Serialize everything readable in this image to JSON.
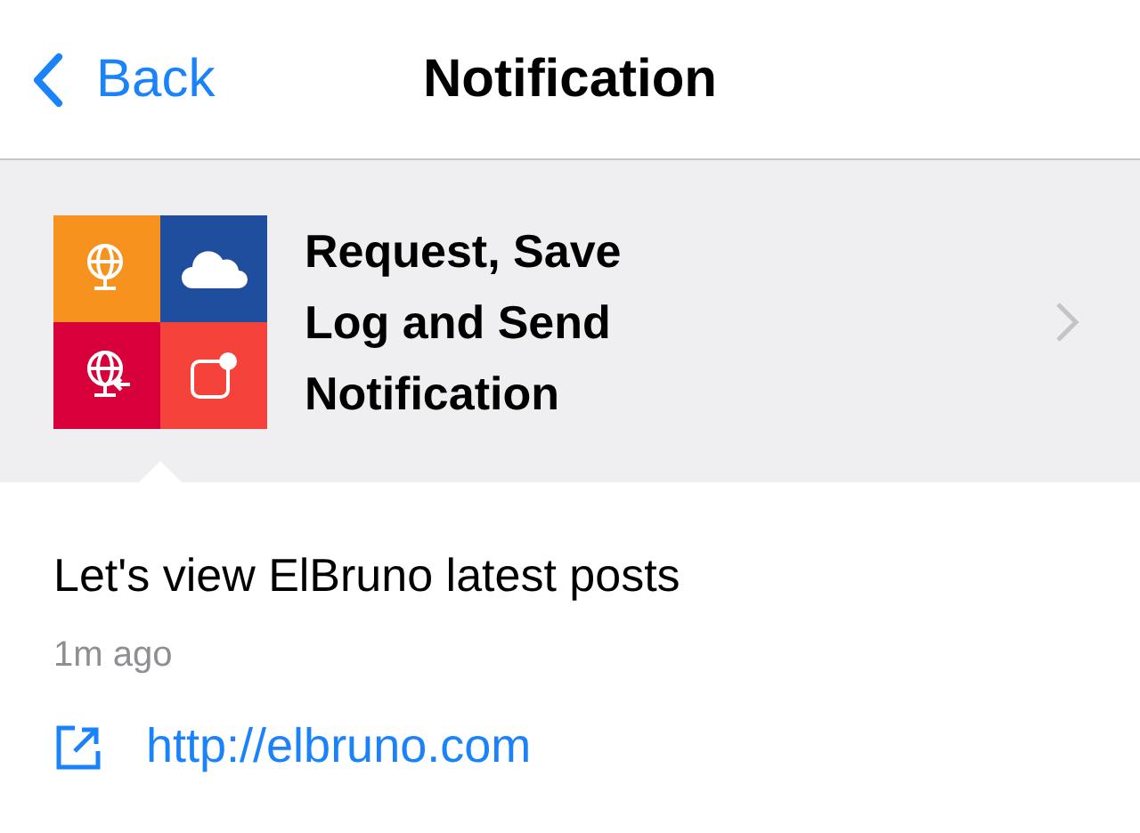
{
  "nav": {
    "back": "Back",
    "title": "Notification"
  },
  "applet": {
    "title": "Request, Save Log and Send Notification",
    "tiles": [
      {
        "kind": "globe",
        "color": "#f7921e"
      },
      {
        "kind": "cloud",
        "color": "#1f4e9e"
      },
      {
        "kind": "globe-in",
        "color": "#d8003b"
      },
      {
        "kind": "notify",
        "color": "#f5423a"
      }
    ]
  },
  "message": "Let's view ElBruno latest posts",
  "time": "1m ago",
  "link": "http://elbruno.com"
}
